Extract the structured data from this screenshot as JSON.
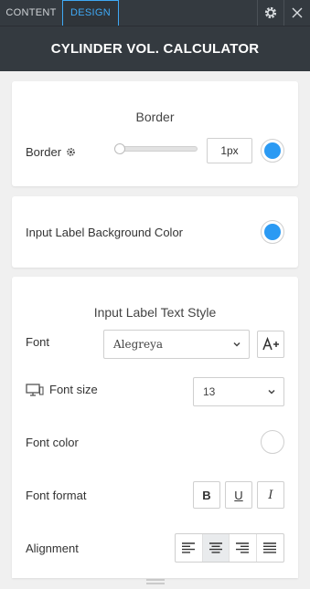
{
  "tabs": {
    "content": "CONTENT",
    "design": "DESIGN"
  },
  "header": {
    "title": "CYLINDER VOL. CALCULATOR"
  },
  "border_card": {
    "title": "Border",
    "label": "Border",
    "slider_value": 0.0,
    "width_value": "1px",
    "color": "#2b9af3"
  },
  "bg_card": {
    "label": "Input Label Background Color",
    "color": "#2b9af3"
  },
  "text_style_card": {
    "title": "Input Label Text Style",
    "font_label": "Font",
    "font_value": "Alegreya",
    "font_size_label": "Font size",
    "font_size_value": "13",
    "font_color_label": "Font color",
    "font_color": "#ffffff",
    "font_format_label": "Font format",
    "format_bold": "B",
    "format_underline": "U",
    "format_italic": "I",
    "alignment_label": "Alignment",
    "alignment_selected": "center"
  },
  "icons": [
    "gear-icon",
    "close-icon",
    "small-gear-icon",
    "font-plus-icon",
    "desktop-icon",
    "chevron-down-icon",
    "align-left-icon",
    "align-center-icon",
    "align-right-icon",
    "align-justify-icon",
    "drag-handle-icon"
  ]
}
